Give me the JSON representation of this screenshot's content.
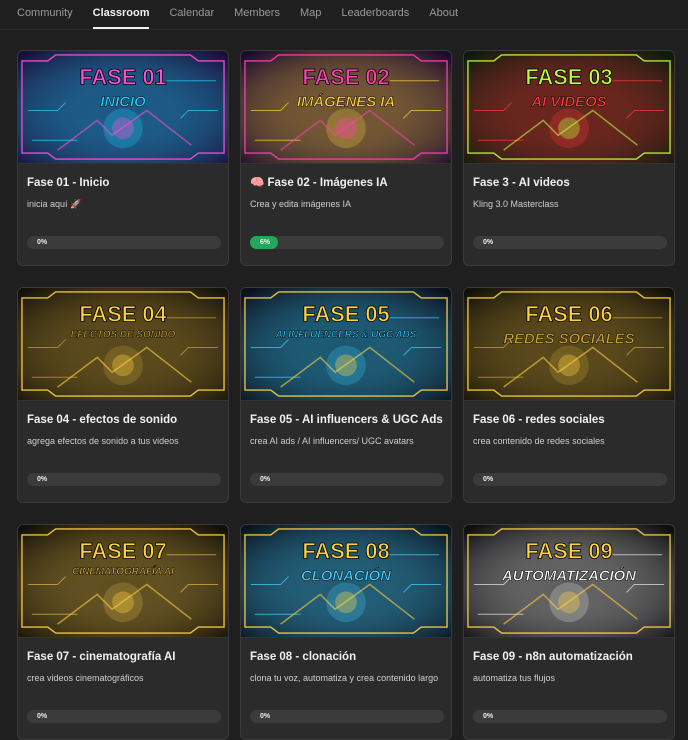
{
  "nav": {
    "tabs": [
      {
        "label": "Community"
      },
      {
        "label": "Classroom",
        "active": true
      },
      {
        "label": "Calendar"
      },
      {
        "label": "Members"
      },
      {
        "label": "Map"
      },
      {
        "label": "Leaderboards"
      },
      {
        "label": "About"
      }
    ]
  },
  "courses": [
    {
      "title": "Fase 01 - Inicio",
      "desc": "inicia aquí 🚀",
      "progress": "0%",
      "progress_value": 0,
      "thumb_title": "FASE 01",
      "thumb_sub": "INICIO",
      "icon": "rocket-icon",
      "colors": [
        "#1a0f3a",
        "#ff4fd8",
        "#21d4ff"
      ]
    },
    {
      "title": "🧠 Fase 02 - Imágenes IA",
      "desc": "Crea y edita imágenes IA",
      "progress": "6%",
      "progress_value": 6,
      "thumb_title": "FASE 02",
      "thumb_sub": "IMÁGENES IA",
      "icon": "brain-icon",
      "colors": [
        "#1b0a2e",
        "#ff3fb4",
        "#ffd23f"
      ]
    },
    {
      "title": "Fase 3 - AI videos",
      "desc": "Kling 3.0 Masterclass",
      "progress": "0%",
      "progress_value": 0,
      "thumb_title": "FASE 03",
      "thumb_sub": "AI VIDEOS",
      "icon": "camera-icon",
      "colors": [
        "#0d1a0d",
        "#b8ff3a",
        "#ff3a3a"
      ]
    },
    {
      "title": "Fase 04 - efectos de sonido",
      "desc": "agrega efectos de sonido a tus videos",
      "progress": "0%",
      "progress_value": 0,
      "thumb_title": "FASE 04",
      "thumb_sub": "EFECTOS DE SONIDO",
      "icon": "soundwave-icon",
      "colors": [
        "#15120a",
        "#ffd23f",
        "#c9a23a"
      ]
    },
    {
      "title": "Fase 05 - AI influencers & UGC Ads",
      "desc": "crea AI ads / AI influencers/ UGC avatars",
      "progress": "0%",
      "progress_value": 0,
      "thumb_title": "FASE 05",
      "thumb_sub": "AI INFLUENCERS & UGC ADS",
      "icon": "avatar-icon",
      "colors": [
        "#0c0f1c",
        "#ffd23f",
        "#3ad1ff"
      ]
    },
    {
      "title": "Fase 06 - redes sociales",
      "desc": "crea contenido de redes sociales",
      "progress": "0%",
      "progress_value": 0,
      "thumb_title": "FASE 06",
      "thumb_sub": "REDES SOCIALES",
      "icon": "network-icon",
      "colors": [
        "#121008",
        "#ffd23f",
        "#c9a23a"
      ]
    },
    {
      "title": "Fase 07 - cinematografía AI",
      "desc": "crea videos cinematográficos",
      "progress": "0%",
      "progress_value": 0,
      "thumb_title": "FASE 07",
      "thumb_sub": "CINEMATOGRAFÍA AI",
      "icon": "clapper-icon",
      "colors": [
        "#120f08",
        "#ffd23f",
        "#e0b84a"
      ]
    },
    {
      "title": "Fase 08 - clonación",
      "desc": "clona tu voz, automatiza y crea contenido largo",
      "progress": "0%",
      "progress_value": 0,
      "thumb_title": "FASE 08",
      "thumb_sub": "CLONACIÓN",
      "icon": "clone-icon",
      "colors": [
        "#0a1420",
        "#ffd23f",
        "#4ad1ff"
      ]
    },
    {
      "title": "Fase 09 - n8n automatización",
      "desc": "automatiza tus flujos",
      "progress": "0%",
      "progress_value": 0,
      "thumb_title": "FASE 09",
      "thumb_sub": "AUTOMATIZACIÓN",
      "icon": "flow-icon",
      "colors": [
        "#0e0e10",
        "#ffd23f",
        "#e8e8e8"
      ]
    }
  ],
  "colors": {
    "accent_progress": "#22a85a",
    "card_bg": "#2b2b2b",
    "page_bg": "#1f1f1f"
  }
}
